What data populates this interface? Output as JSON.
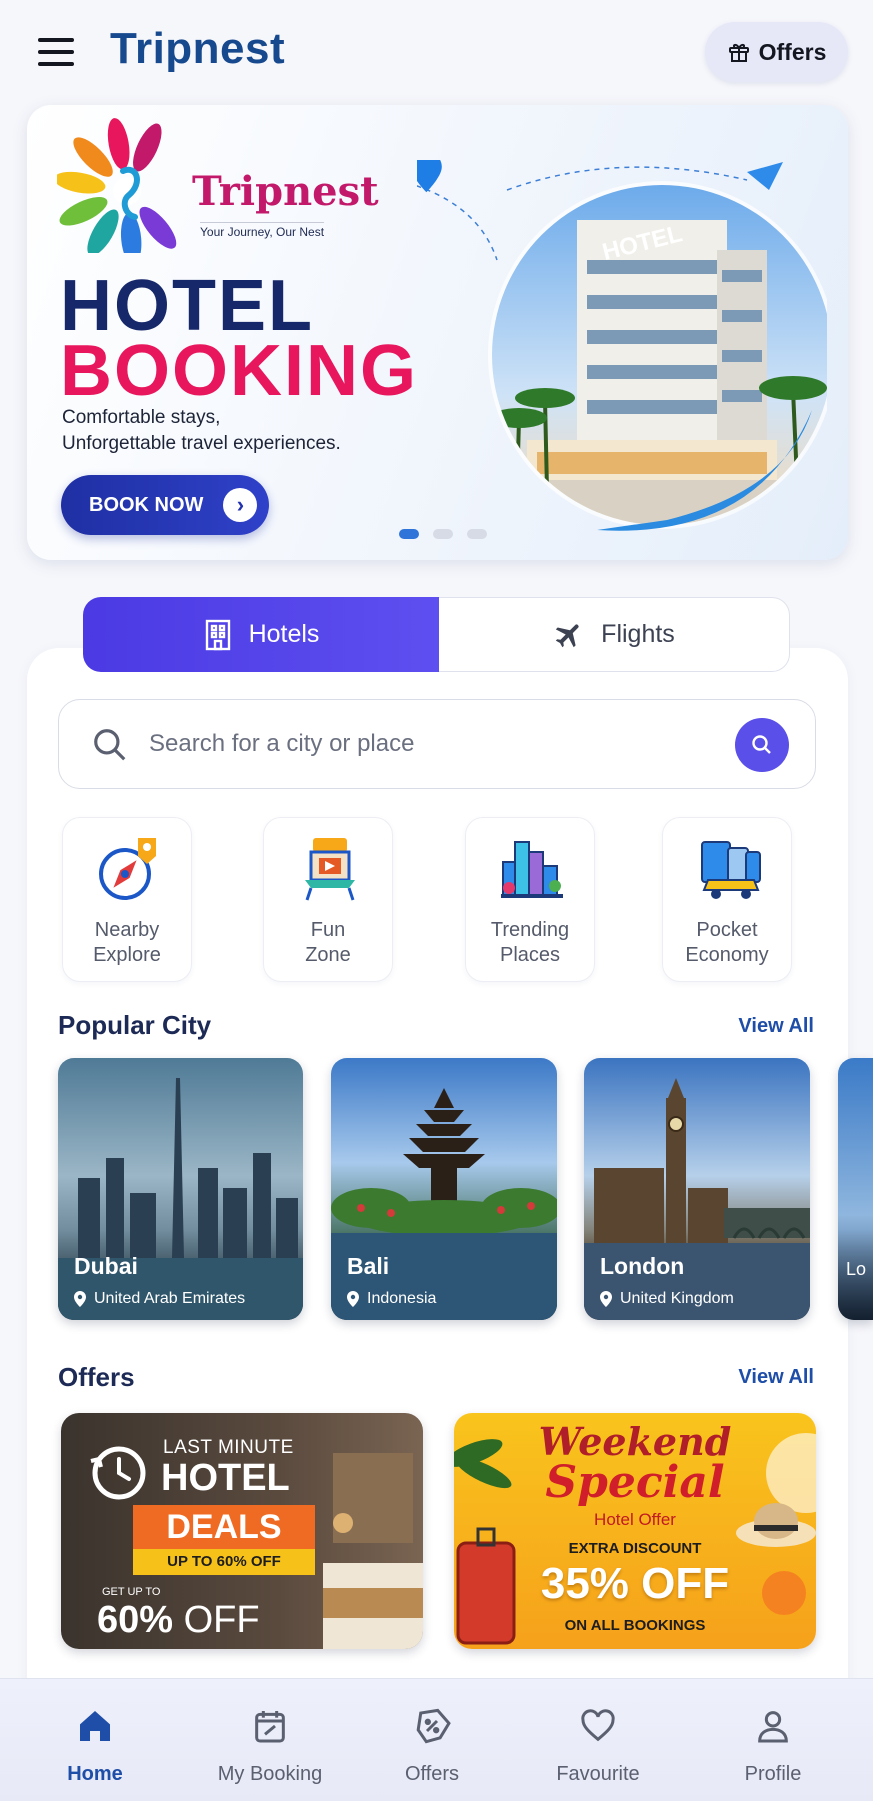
{
  "header": {
    "brand": "Tripnest",
    "offers_label": "Offers"
  },
  "banner": {
    "logo_name": "Tripnest",
    "logo_tagline": "Your Journey, Our Nest",
    "title_line1": "HOTEL",
    "title_line2": "BOOKING",
    "subtitle_line1": "Comfortable stays,",
    "subtitle_line2": "Unforgettable travel experiences.",
    "cta_label": "BOOK NOW",
    "hotel_sign": "HOTEL",
    "slide_count": 3,
    "active_slide": 1
  },
  "tabs": [
    {
      "label": "Hotels",
      "active": true
    },
    {
      "label": "Flights",
      "active": false
    }
  ],
  "search": {
    "placeholder": "Search for a city or place"
  },
  "categories": [
    {
      "line1": "Nearby",
      "line2": "Explore",
      "icon": "compass-pin-icon"
    },
    {
      "line1": "Fun",
      "line2": "Zone",
      "icon": "carnival-booth-icon"
    },
    {
      "line1": "Trending",
      "line2": "Places",
      "icon": "city-buildings-icon"
    },
    {
      "line1": "Pocket",
      "line2": "Economy",
      "icon": "luggage-car-icon"
    }
  ],
  "popular_city": {
    "title": "Popular City",
    "view_all": "View All",
    "cities": [
      {
        "name": "Dubai",
        "country": "United Arab Emirates"
      },
      {
        "name": "Bali",
        "country": "Indonesia"
      },
      {
        "name": "London",
        "country": "United Kingdom"
      },
      {
        "name": "Lo",
        "country": ""
      }
    ]
  },
  "offers": {
    "title": "Offers",
    "view_all": "View All",
    "cards": [
      {
        "top": "LAST MINUTE",
        "headline": "HOTEL",
        "badge": "DEALS",
        "strip": "UP TO 60% OFF",
        "small": "GET UP TO",
        "big_value": "60%",
        "big_suffix": "OFF"
      },
      {
        "script1": "Weekend",
        "script2": "Special",
        "subtitle": "Hotel Offer",
        "extra": "EXTRA DISCOUNT",
        "big": "35% OFF",
        "footer": "ON ALL BOOKINGS"
      }
    ]
  },
  "bottom_nav": [
    {
      "label": "Home",
      "active": true,
      "icon": "home-icon"
    },
    {
      "label": "My Booking",
      "active": false,
      "icon": "calendar-check-icon"
    },
    {
      "label": "Offers",
      "active": false,
      "icon": "discount-tag-icon"
    },
    {
      "label": "Favourite",
      "active": false,
      "icon": "heart-icon"
    },
    {
      "label": "Profile",
      "active": false,
      "icon": "user-icon"
    }
  ],
  "colors": {
    "brand": "#17498e",
    "accent": "#5a4fe8",
    "pink": "#e8175d",
    "navy": "#16276a",
    "link": "#1f4ea8"
  }
}
